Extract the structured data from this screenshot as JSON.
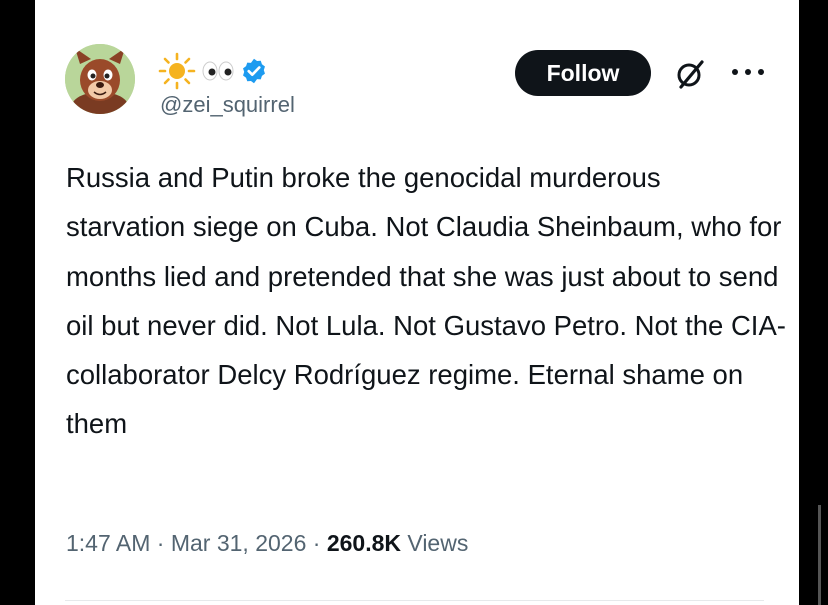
{
  "tweet": {
    "display_name_icons": [
      "sun-icon",
      "eyes-icon"
    ],
    "verified": true,
    "handle": "@zei_squirrel",
    "follow_label": "Follow",
    "text": "Russia and Putin broke the genocidal murderous starvation siege on Cuba. Not Claudia Sheinbaum, who for months lied and pretended that she was just about to send oil but never did. Not Lula. Not Gustavo Petro. Not the CIA-collaborator Delcy Rodríguez regime. Eternal shame on them",
    "time": "1:47 AM",
    "separator": "·",
    "date": "Mar 31, 2026",
    "views_count": "260.8K",
    "views_label": "Views"
  },
  "colors": {
    "text": "#0f1419",
    "secondary": "#536471",
    "verified": "#1d9bf0",
    "button": "#0f1419"
  }
}
